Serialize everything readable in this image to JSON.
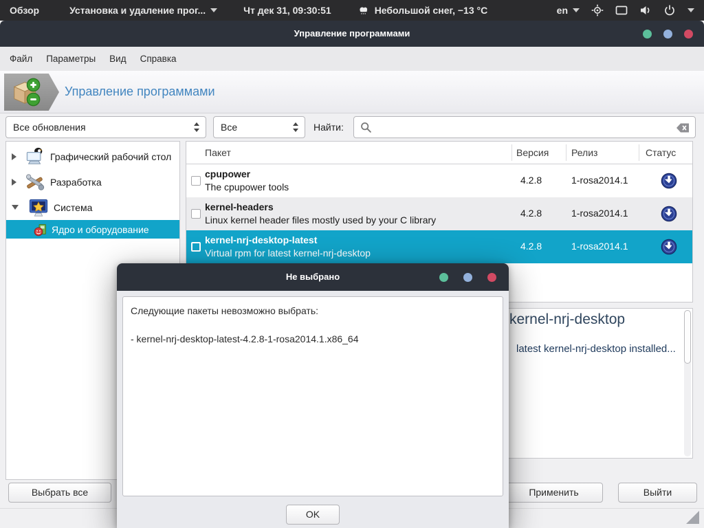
{
  "topbar": {
    "overview": "Обзор",
    "app_menu": "Установка и удаление прог...",
    "clock": "Чт дек 31, 09:30:51",
    "weather": "Небольшой снег, −13 °C",
    "language": "en"
  },
  "window": {
    "title": "Управление программами"
  },
  "menubar": {
    "items": [
      "Файл",
      "Параметры",
      "Вид",
      "Справка"
    ]
  },
  "banner": {
    "title": "Управление программами"
  },
  "filters": {
    "category_filter": "Все обновления",
    "status_filter": "Все",
    "search_label": "Найти:",
    "search_value": ""
  },
  "tree": {
    "items": [
      {
        "label": "Графический рабочий стол",
        "icon": "desktop-icon",
        "expander": "closed"
      },
      {
        "label": "Разработка",
        "icon": "tools-icon",
        "expander": "closed"
      },
      {
        "label": "Система",
        "icon": "system-icon",
        "expander": "open"
      },
      {
        "label": "Ядро и оборудование",
        "icon": "hardware-icon",
        "expander": "none",
        "state": "selected",
        "indent": true
      }
    ]
  },
  "table": {
    "columns": [
      "Пакет",
      "Версия",
      "Релиз",
      "Статус"
    ],
    "rows": [
      {
        "name": "cpupower",
        "description": "The cpupower tools",
        "version": "4.2.8",
        "release": "1-rosa2014.1",
        "status_icon": "download-icon"
      },
      {
        "name": "kernel-headers",
        "description": "Linux kernel header files mostly used by your C library",
        "version": "4.2.8",
        "release": "1-rosa2014.1",
        "status_icon": "download-icon"
      },
      {
        "name": "kernel-nrj-desktop-latest",
        "description": "Virtual rpm for latest kernel-nrj-desktop",
        "version": "4.2.8",
        "release": "1-rosa2014.1",
        "status_icon": "download-icon",
        "state": "selected"
      }
    ]
  },
  "details": {
    "heading": "kernel-nrj-desktop",
    "note": "latest kernel-nrj-desktop installed..."
  },
  "actions": {
    "select_all": "Выбрать все",
    "apply": "Применить",
    "quit": "Выйти"
  },
  "dialog": {
    "title": "Не выбрано",
    "message": "Следующие пакеты невозможно выбрать:",
    "package_line": "- kernel-nrj-desktop-latest-4.2.8-1-rosa2014.1.x86_64",
    "ok_label": "OK"
  },
  "colors": {
    "selection": "#12a4c9",
    "accent_blue": "#4386c0",
    "status_icon_blue": "#2a3f92",
    "dot_green": "#5cbf9b",
    "dot_blue": "#93b1dc",
    "dot_red": "#d24a63"
  }
}
